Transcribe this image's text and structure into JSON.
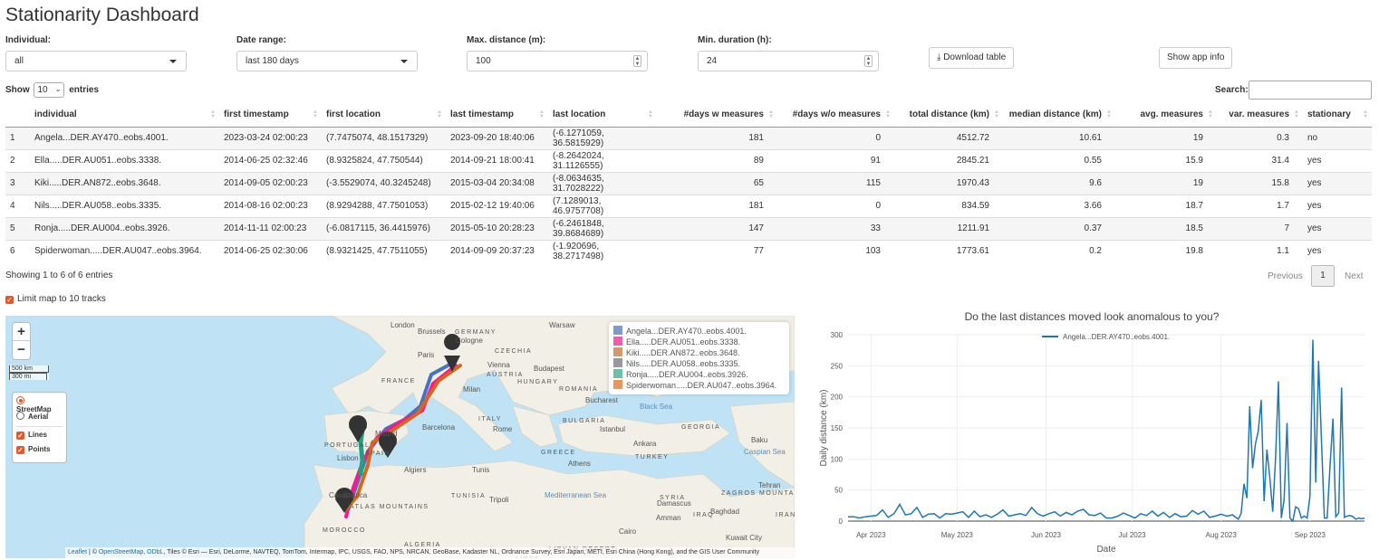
{
  "title": "Stationarity Dashboard",
  "controls": {
    "individual": {
      "label": "Individual:",
      "value": "all"
    },
    "date_range": {
      "label": "Date range:",
      "value": "last 180 days"
    },
    "max_distance": {
      "label": "Max. distance (m):",
      "value": "100"
    },
    "min_duration": {
      "label": "Min. duration (h):",
      "value": "24"
    },
    "download_label": "Download table",
    "app_info_label": "Show app info"
  },
  "table": {
    "show_label": "Show",
    "entries_value": "10",
    "entries_label": "entries",
    "search_label": "Search:",
    "columns": [
      "",
      "individual",
      "first timestamp",
      "first location",
      "last timestamp",
      "last location",
      "#days w measures",
      "#days w/o measures",
      "total distance (km)",
      "median distance (km)",
      "avg. measures",
      "var. measures",
      "stationary"
    ],
    "rows": [
      [
        "1",
        "Angela...DER.AY470..eobs.4001.",
        "2023-03-24 02:00:23",
        "(7.7475074, 48.1517329)",
        "2023-09-20 18:40:06",
        "(-6.1271059, 36.5815929)",
        "181",
        "0",
        "4512.72",
        "10.61",
        "19",
        "0.3",
        "no"
      ],
      [
        "2",
        "Ella.....DER.AU051..eobs.3338.",
        "2014-06-25 02:32:46",
        "(8.9325824, 47.750544)",
        "2014-09-21 18:00:41",
        "(-8.2642024, 31.1126555)",
        "89",
        "91",
        "2845.21",
        "0.55",
        "15.9",
        "31.4",
        "yes"
      ],
      [
        "3",
        "Kiki.....DER.AN872..eobs.3648.",
        "2014-09-05 02:00:23",
        "(-3.5529074, 40.3245248)",
        "2015-03-04 20:34:08",
        "(-8.0634635, 31.7028222)",
        "65",
        "115",
        "1970.43",
        "9.6",
        "19",
        "15.8",
        "yes"
      ],
      [
        "4",
        "Nils.....DER.AU058..eobs.3335.",
        "2014-08-16 02:00:23",
        "(8.9294288, 47.7501053)",
        "2015-02-12 19:40:06",
        "(7.1289013, 46.9757708)",
        "181",
        "0",
        "834.59",
        "3.66",
        "18.7",
        "1.7",
        "yes"
      ],
      [
        "5",
        "Ronja.....DER.AU004..eobs.3926.",
        "2014-11-11 02:00:23",
        "(-6.0817115, 36.4415976)",
        "2015-05-10 20:28:23",
        "(-6.2461848, 39.8684689)",
        "147",
        "33",
        "1211.91",
        "0.37",
        "18.5",
        "7",
        "yes"
      ],
      [
        "6",
        "Spiderwoman.....DER.AU047..eobs.3964.",
        "2014-06-25 02:30:06",
        "(8.9321425, 47.7511055)",
        "2014-09-09 20:37:23",
        "(-1.920696, 38.2717498)",
        "77",
        "103",
        "1773.61",
        "0.2",
        "19.8",
        "1.1",
        "yes"
      ]
    ],
    "info": "Showing 1 to 6 of 6 entries",
    "pagination": {
      "previous": "Previous",
      "page": "1",
      "next": "Next"
    }
  },
  "limit_map": {
    "label": "Limit map to 10 tracks",
    "checked": true
  },
  "map": {
    "zoom_in": "+",
    "zoom_out": "−",
    "scale": [
      "500 km",
      "300 mi"
    ],
    "layers": {
      "base": [
        {
          "label": "StreetMap",
          "selected": true
        },
        {
          "label": "Aerial",
          "selected": false
        }
      ],
      "overlays": [
        {
          "label": "Lines",
          "checked": true
        },
        {
          "label": "Points",
          "checked": true
        }
      ]
    },
    "legend": [
      {
        "label": "Angela...DER.AY470..eobs.4001.",
        "color": "#7b9ccc"
      },
      {
        "label": "Ella.....DER.AU051..eobs.3338.",
        "color": "#ef5fa8"
      },
      {
        "label": "Kiki.....DER.AN872..eobs.3648.",
        "color": "#d6996b"
      },
      {
        "label": "Nils.....DER.AU058..eobs.3335.",
        "color": "#999999"
      },
      {
        "label": "Ronja.....DER.AU004..eobs.3926.",
        "color": "#6cc0a8"
      },
      {
        "label": "Spiderwoman.....DER.AU047..eobs.3964.",
        "color": "#e8975c"
      }
    ],
    "places": [
      "London",
      "Brussels",
      "GERMANY",
      "Cologne",
      "Paris",
      "CZECHIA",
      "Vienna",
      "Warsaw",
      "FRANCE",
      "AUSTRIA",
      "HUNGARY",
      "Budapest",
      "Milan",
      "ROMANIA",
      "Bucharest",
      "UKRAINE",
      "ITALY",
      "Rome",
      "Barcelona",
      "Madrid",
      "PORTUGAL",
      "Lisbon",
      "SPAIN",
      "BULGARIA",
      "Istanbul",
      "Black Sea",
      "GEORGIA",
      "Baku",
      "Caspian Sea",
      "Ankara",
      "TURKEY",
      "GREECE",
      "Athens",
      "Algiers",
      "Tunis",
      "TUNISIA",
      "Tripoli",
      "Mediterranean Sea",
      "SYRIA",
      "Damascus",
      "IRAQ",
      "Baghdad",
      "Amman",
      "Tehran",
      "IRAN",
      "ZAGROS MOUNTAINS",
      "Cairo",
      "Kuwait City",
      "LIBYAN DESERT",
      "LIBYA",
      "ALGERIA",
      "MOROCCO",
      "Casablanca",
      "ATLAS MOUNTAINS"
    ],
    "attribution": {
      "leaflet": "Leaflet",
      "osm": "OpenStreetMap, ODbL",
      "rest": ", Tiles © Esri — Esri, DeLorme, NAVTEQ, TomTom, Intermap, IPC, USGS, FAO, NPS, NRCAN, GeoBase, Kadaster NL, Ordnance Survey, Esri Japan, METI, Esri China (Hong Kong), and the GIS User Community"
    }
  },
  "chart_data": {
    "type": "line",
    "title": "Do the last distances moved look anomalous to you?",
    "xlabel": "Date",
    "ylabel": "Daily distance (km)",
    "ylim": [
      0,
      300
    ],
    "yticks": [
      0,
      50,
      100,
      150,
      200,
      250,
      300
    ],
    "xticks": [
      "Apr 2023",
      "May 2023",
      "Jun 2023",
      "Jul 2023",
      "Aug 2023",
      "Sep 2023"
    ],
    "xtick_dates": [
      "2023-04-01",
      "2023-05-01",
      "2023-06-01",
      "2023-07-01",
      "2023-08-01",
      "2023-09-01"
    ],
    "xlim": [
      "2023-03-24",
      "2023-09-20"
    ],
    "grid": true,
    "legend_position": "top-center",
    "series": [
      {
        "name": "Angela...DER.AY470..eobs.4001.",
        "color": "#1f77b4",
        "x": [
          "2023-03-24",
          "2023-03-26",
          "2023-03-28",
          "2023-03-30",
          "2023-04-01",
          "2023-04-03",
          "2023-04-05",
          "2023-04-07",
          "2023-04-09",
          "2023-04-11",
          "2023-04-13",
          "2023-04-15",
          "2023-04-17",
          "2023-04-19",
          "2023-04-21",
          "2023-04-23",
          "2023-04-25",
          "2023-04-27",
          "2023-04-29",
          "2023-05-01",
          "2023-05-03",
          "2023-05-05",
          "2023-05-07",
          "2023-05-09",
          "2023-05-11",
          "2023-05-13",
          "2023-05-15",
          "2023-05-17",
          "2023-05-19",
          "2023-05-21",
          "2023-05-23",
          "2023-05-25",
          "2023-05-27",
          "2023-05-29",
          "2023-05-31",
          "2023-06-02",
          "2023-06-04",
          "2023-06-06",
          "2023-06-08",
          "2023-06-10",
          "2023-06-12",
          "2023-06-14",
          "2023-06-16",
          "2023-06-18",
          "2023-06-20",
          "2023-06-22",
          "2023-06-24",
          "2023-06-26",
          "2023-06-28",
          "2023-06-30",
          "2023-07-02",
          "2023-07-04",
          "2023-07-06",
          "2023-07-08",
          "2023-07-10",
          "2023-07-12",
          "2023-07-14",
          "2023-07-16",
          "2023-07-18",
          "2023-07-20",
          "2023-07-22",
          "2023-07-24",
          "2023-07-26",
          "2023-07-28",
          "2023-07-30",
          "2023-08-01",
          "2023-08-03",
          "2023-08-05",
          "2023-08-07",
          "2023-08-08",
          "2023-08-09",
          "2023-08-10",
          "2023-08-11",
          "2023-08-12",
          "2023-08-13",
          "2023-08-14",
          "2023-08-15",
          "2023-08-16",
          "2023-08-17",
          "2023-08-18",
          "2023-08-19",
          "2023-08-20",
          "2023-08-21",
          "2023-08-22",
          "2023-08-23",
          "2023-08-24",
          "2023-08-25",
          "2023-08-26",
          "2023-08-27",
          "2023-08-28",
          "2023-08-29",
          "2023-08-30",
          "2023-08-31",
          "2023-09-01",
          "2023-09-02",
          "2023-09-03",
          "2023-09-04",
          "2023-09-05",
          "2023-09-06",
          "2023-09-07",
          "2023-09-08",
          "2023-09-09",
          "2023-09-10",
          "2023-09-11",
          "2023-09-12",
          "2023-09-13",
          "2023-09-14",
          "2023-09-15",
          "2023-09-16",
          "2023-09-17",
          "2023-09-18",
          "2023-09-19",
          "2023-09-20"
        ],
        "values": [
          7,
          7,
          5,
          7,
          8,
          9,
          18,
          6,
          12,
          27,
          10,
          12,
          22,
          6,
          11,
          12,
          5,
          12,
          11,
          13,
          15,
          6,
          16,
          7,
          10,
          6,
          11,
          18,
          8,
          10,
          12,
          9,
          22,
          12,
          8,
          12,
          15,
          8,
          14,
          10,
          16,
          19,
          10,
          9,
          13,
          5,
          5,
          8,
          13,
          9,
          5,
          12,
          9,
          16,
          8,
          14,
          6,
          12,
          7,
          8,
          17,
          11,
          16,
          6,
          8,
          11,
          8,
          10,
          3,
          12,
          60,
          37,
          185,
          85,
          125,
          145,
          195,
          32,
          115,
          70,
          15,
          100,
          225,
          5,
          35,
          158,
          5,
          0,
          23,
          20,
          5,
          8,
          5,
          40,
          292,
          62,
          258,
          130,
          5,
          5,
          90,
          165,
          7,
          13,
          215,
          6,
          8,
          9,
          7,
          3,
          5,
          4,
          5
        ]
      }
    ]
  }
}
